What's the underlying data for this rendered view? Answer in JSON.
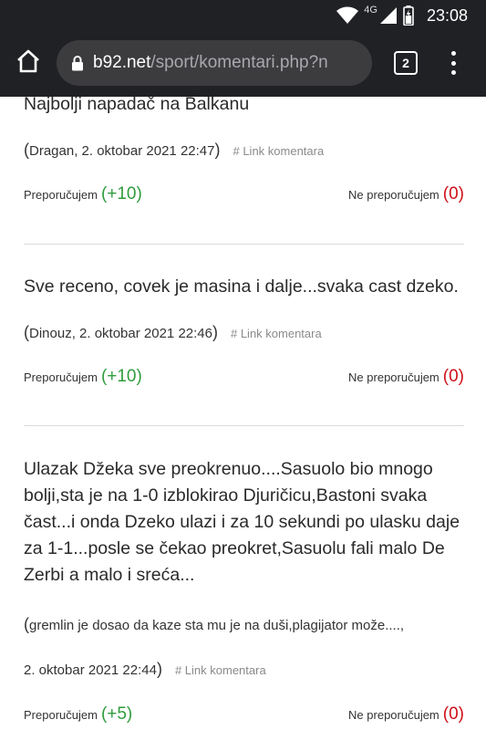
{
  "status_bar": {
    "network": "4G",
    "time": "23:08"
  },
  "toolbar": {
    "url_host": "b92.net",
    "url_path": "/sport/komentari.php?n",
    "tab_count": "2"
  },
  "comments": [
    {
      "text": "Najbolji napadač na Balkanu",
      "meta": "Dragan, 2. oktobar 2021 22:47",
      "link_label": "# Link komentara",
      "recommend_label": "Preporučujem",
      "recommend_count": "(+10)",
      "not_recommend_label": "Ne preporučujem",
      "not_recommend_count": "(0)"
    },
    {
      "text": "Sve receno, covek je masina i dalje...svaka cast dzeko.",
      "meta": "Dinouz, 2. oktobar 2021 22:46",
      "link_label": "# Link komentara",
      "recommend_label": "Preporučujem",
      "recommend_count": "(+10)",
      "not_recommend_label": "Ne preporučujem",
      "not_recommend_count": "(0)"
    },
    {
      "text": "Ulazak Džeka sve preokrenuo....Sasuolo bio mnogo bolji,sta je na 1-0 izblokirao Djuričicu,Bastoni svaka čast...i onda Dzeko ulazi i za 10 sekundi po ulasku daje za 1-1...posle se čekao preokret,Sasuolu fali malo De Zerbi a malo i sreća...",
      "meta_line1": "gremlin je dosao da kaze sta mu je na duši,plagijator može....,",
      "meta_line2": "2. oktobar 2021 22:44",
      "link_label": "# Link komentara",
      "recommend_label": "Preporučujem",
      "recommend_count": "(+5)",
      "not_recommend_label": "Ne preporučujem",
      "not_recommend_count": "(0)"
    }
  ]
}
